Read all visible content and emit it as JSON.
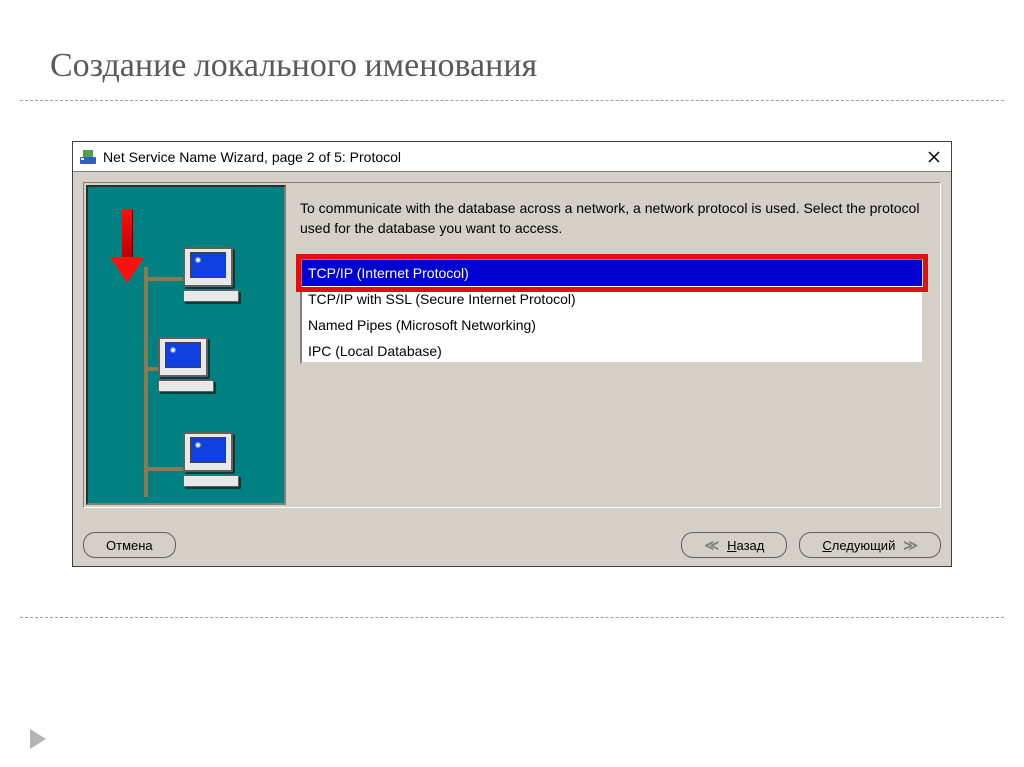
{
  "slide": {
    "title": "Создание локального именования"
  },
  "window": {
    "title": "Net Service Name Wizard, page 2 of 5: Protocol",
    "instructions": "To communicate with the database across a network, a network protocol is used.  Select the protocol used for the database you want to access.",
    "protocols": {
      "item0": "TCP/IP (Internet Protocol)",
      "item1": "TCP/IP with SSL (Secure Internet Protocol)",
      "item2": "Named Pipes (Microsoft Networking)",
      "item3": "IPC (Local Database)"
    },
    "buttons": {
      "cancel": "Отмена",
      "back_prefix": "Н",
      "back_rest": "азад",
      "next_prefix": "С",
      "next_rest": "ледующий"
    }
  }
}
